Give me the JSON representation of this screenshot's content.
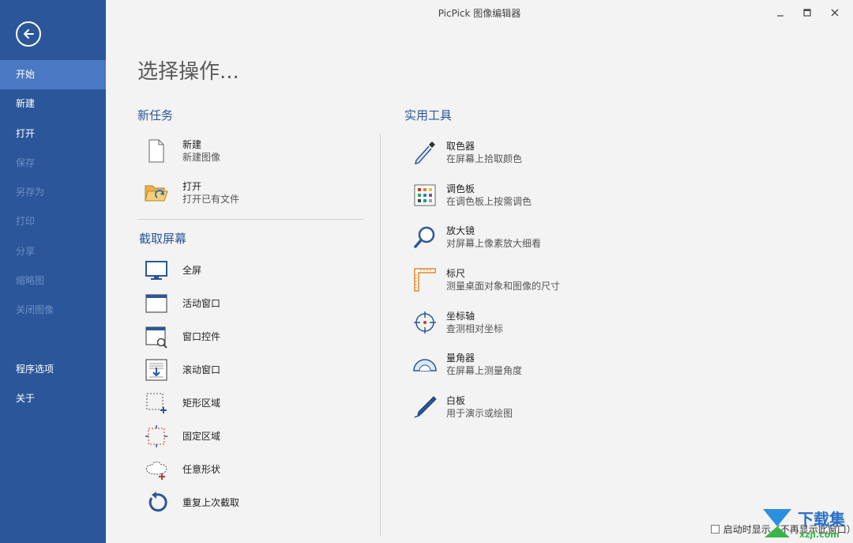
{
  "window": {
    "title": "PicPick 图像编辑器"
  },
  "sidebar": {
    "items": [
      {
        "label": "开始",
        "state": "active"
      },
      {
        "label": "新建",
        "state": "normal"
      },
      {
        "label": "打开",
        "state": "normal"
      },
      {
        "label": "保存",
        "state": "disabled"
      },
      {
        "label": "另存为",
        "state": "disabled"
      },
      {
        "label": "打印",
        "state": "disabled"
      },
      {
        "label": "分享",
        "state": "disabled"
      },
      {
        "label": "缩略图",
        "state": "disabled"
      },
      {
        "label": "关闭图像",
        "state": "disabled"
      }
    ],
    "bottom_items": [
      {
        "label": "程序选项"
      },
      {
        "label": "关于"
      }
    ]
  },
  "main": {
    "title": "选择操作...",
    "new_task": {
      "heading": "新任务",
      "items": [
        {
          "label": "新建",
          "desc": "新建图像",
          "icon": "new-file-icon"
        },
        {
          "label": "打开",
          "desc": "打开已有文件",
          "icon": "open-folder-icon"
        }
      ]
    },
    "capture": {
      "heading": "截取屏幕",
      "items": [
        {
          "label": "全屏",
          "icon": "monitor-icon"
        },
        {
          "label": "活动窗口",
          "icon": "window-icon"
        },
        {
          "label": "窗口控件",
          "icon": "window-control-icon"
        },
        {
          "label": "滚动窗口",
          "icon": "scroll-window-icon"
        },
        {
          "label": "矩形区域",
          "icon": "rectangle-region-icon"
        },
        {
          "label": "固定区域",
          "icon": "fixed-region-icon"
        },
        {
          "label": "任意形状",
          "icon": "freehand-shape-icon"
        },
        {
          "label": "重复上次截取",
          "icon": "repeat-capture-icon"
        }
      ]
    },
    "tools": {
      "heading": "实用工具",
      "items": [
        {
          "label": "取色器",
          "desc": "在屏幕上拾取颜色",
          "icon": "eyedropper-icon"
        },
        {
          "label": "调色板",
          "desc": "在调色板上按需调色",
          "icon": "palette-icon"
        },
        {
          "label": "放大镜",
          "desc": "对屏幕上像素放大细看",
          "icon": "magnifier-icon"
        },
        {
          "label": "标尺",
          "desc": "测量桌面对象和图像的尺寸",
          "icon": "ruler-icon"
        },
        {
          "label": "坐标轴",
          "desc": "查测相对坐标",
          "icon": "crosshair-icon"
        },
        {
          "label": "量角器",
          "desc": "在屏幕上测量角度",
          "icon": "protractor-icon"
        },
        {
          "label": "白板",
          "desc": "用于演示或绘图",
          "icon": "pen-icon"
        }
      ]
    },
    "startup_option": {
      "label": "启动时显示（不再显示此窗口）",
      "checked": false
    }
  },
  "watermark": {
    "text": "下载集",
    "sub": "xzji.com"
  },
  "colors": {
    "sidebar": "#2b579a",
    "sidebar_active": "#4a78c2",
    "accent": "#2b579a",
    "background": "#f3f3f3"
  }
}
